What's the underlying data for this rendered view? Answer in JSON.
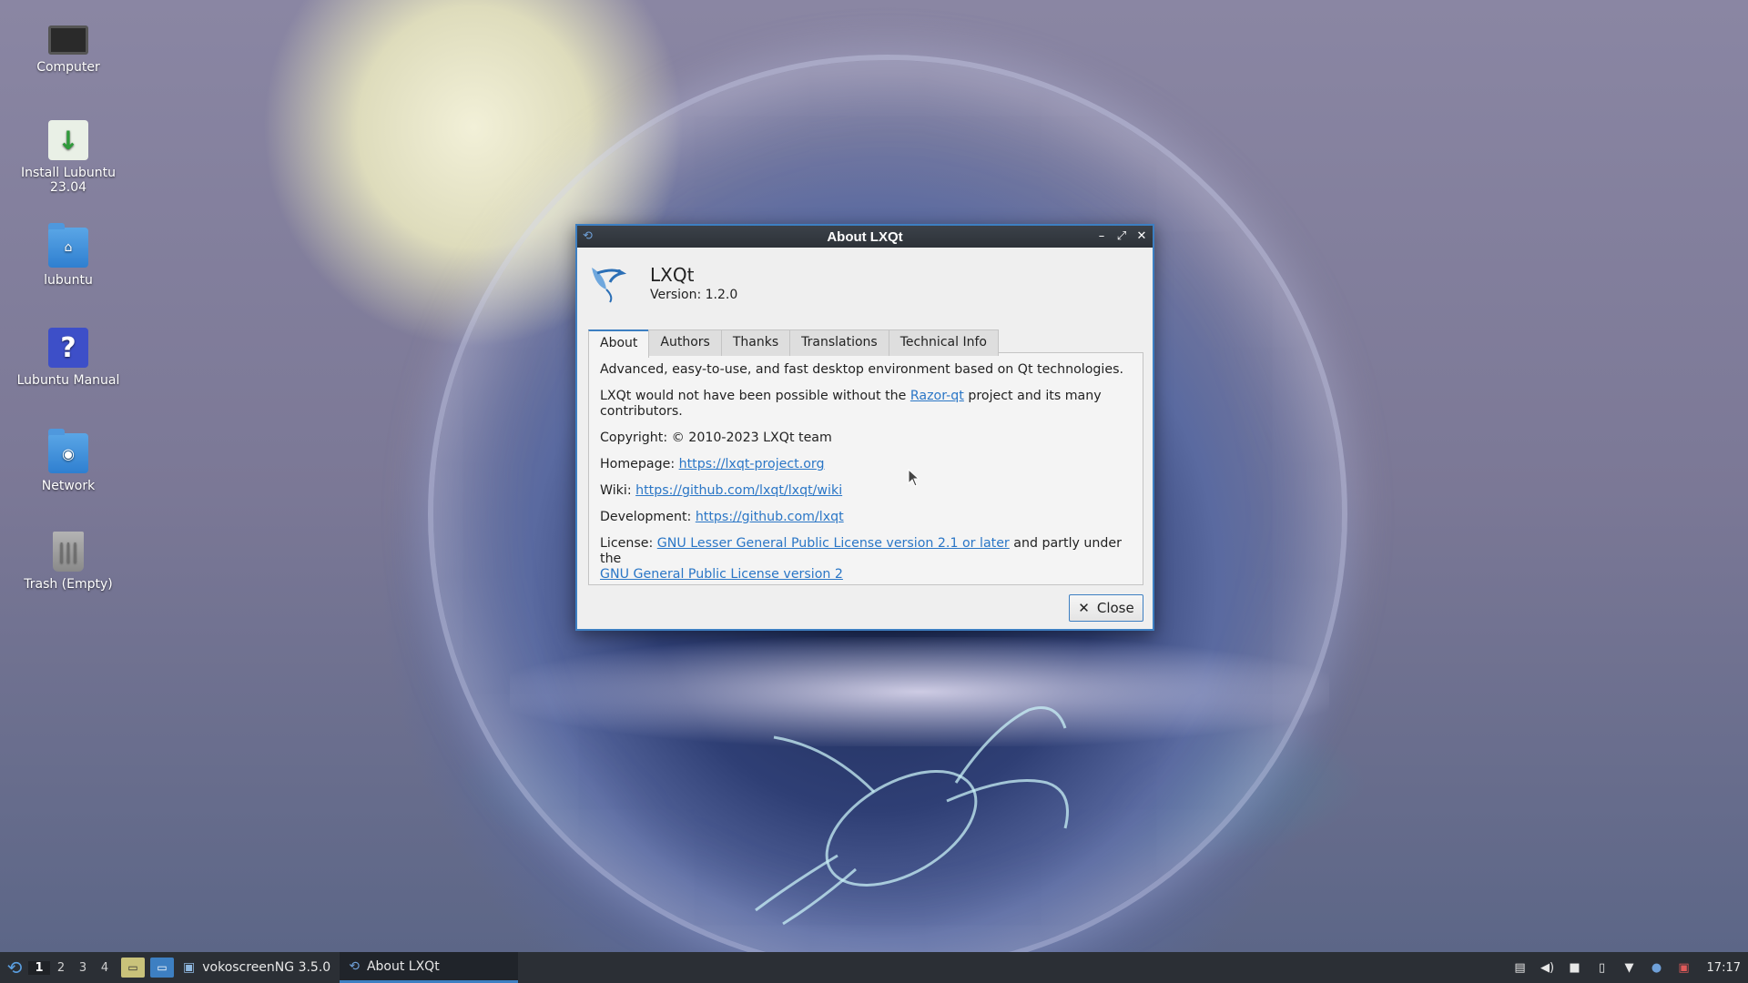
{
  "desktop": {
    "icons": [
      {
        "label": "Computer"
      },
      {
        "label": "Install Lubuntu 23.04"
      },
      {
        "label": "lubuntu"
      },
      {
        "label": "Lubuntu Manual"
      },
      {
        "label": "Network"
      },
      {
        "label": "Trash (Empty)"
      }
    ]
  },
  "dialog": {
    "title": "About LXQt",
    "app_name": "LXQt",
    "version": "Version: 1.2.0",
    "tabs": [
      {
        "label": "About"
      },
      {
        "label": "Authors"
      },
      {
        "label": "Thanks"
      },
      {
        "label": "Translations"
      },
      {
        "label": "Technical Info"
      }
    ],
    "about": {
      "description": "Advanced, easy-to-use, and fast desktop environment based on Qt technologies.",
      "razor_pre": "LXQt would not have been possible without the ",
      "razor_link": "Razor-qt",
      "razor_post": " project and its many contributors.",
      "copyright": "Copyright: © 2010-2023 LXQt team",
      "homepage_label": "Homepage: ",
      "homepage_link": "https://lxqt-project.org",
      "wiki_label": "Wiki: ",
      "wiki_link": "https://github.com/lxqt/lxqt/wiki",
      "dev_label": "Development: ",
      "dev_link": "https://github.com/lxqt",
      "license_label": "License: ",
      "license_link1": "GNU Lesser General Public License version 2.1 or later",
      "license_mid": " and partly under the ",
      "license_link2": "GNU General Public License version 2"
    },
    "close_label": "Close"
  },
  "taskbar": {
    "desktops": [
      "1",
      "2",
      "3",
      "4"
    ],
    "tasks": [
      {
        "label": "vokoscreenNG 3.5.0"
      },
      {
        "label": "About LXQt"
      }
    ],
    "clock": "17:17"
  },
  "colors": {
    "accent": "#3d7fc2",
    "link": "#2a76c6",
    "taskbar_bg": "#2b2f35"
  }
}
